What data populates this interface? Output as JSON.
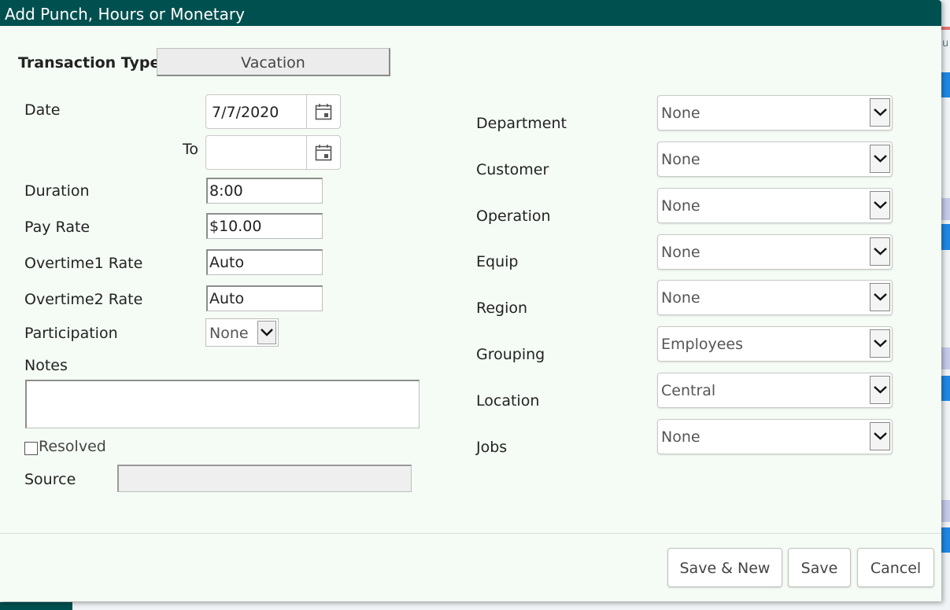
{
  "dialog": {
    "title": "Add Punch, Hours or Monetary"
  },
  "transaction_type": {
    "label": "Transaction Type",
    "value": "Vacation"
  },
  "date": {
    "label": "Date",
    "value": "7/7/2020",
    "to_label": "To",
    "to_value": ""
  },
  "duration": {
    "label": "Duration",
    "value": "8:00"
  },
  "pay_rate": {
    "label": "Pay Rate",
    "value": "$10.00"
  },
  "overtime1": {
    "label": "Overtime1 Rate",
    "value": "Auto"
  },
  "overtime2": {
    "label": "Overtime2 Rate",
    "value": "Auto"
  },
  "participation": {
    "label": "Participation",
    "value": "None"
  },
  "notes": {
    "label": "Notes",
    "value": ""
  },
  "resolved": {
    "label": "Resolved",
    "checked": false
  },
  "source": {
    "label": "Source",
    "value": ""
  },
  "right_fields": [
    {
      "label": "Department",
      "value": "None"
    },
    {
      "label": "Customer",
      "value": "None"
    },
    {
      "label": "Operation",
      "value": "None"
    },
    {
      "label": "Equip",
      "value": "None"
    },
    {
      "label": "Region",
      "value": "None"
    },
    {
      "label": "Grouping",
      "value": "Employees"
    },
    {
      "label": "Location",
      "value": "Central"
    },
    {
      "label": "Jobs",
      "value": "None"
    }
  ],
  "buttons": {
    "save_new": "Save & New",
    "save": "Save",
    "cancel": "Cancel"
  },
  "background": {
    "edge_text": "u"
  },
  "colors": {
    "titlebar": "#00504f",
    "dialog_bg": "#f5fcf5",
    "accent_blue": "#1e88e5"
  }
}
